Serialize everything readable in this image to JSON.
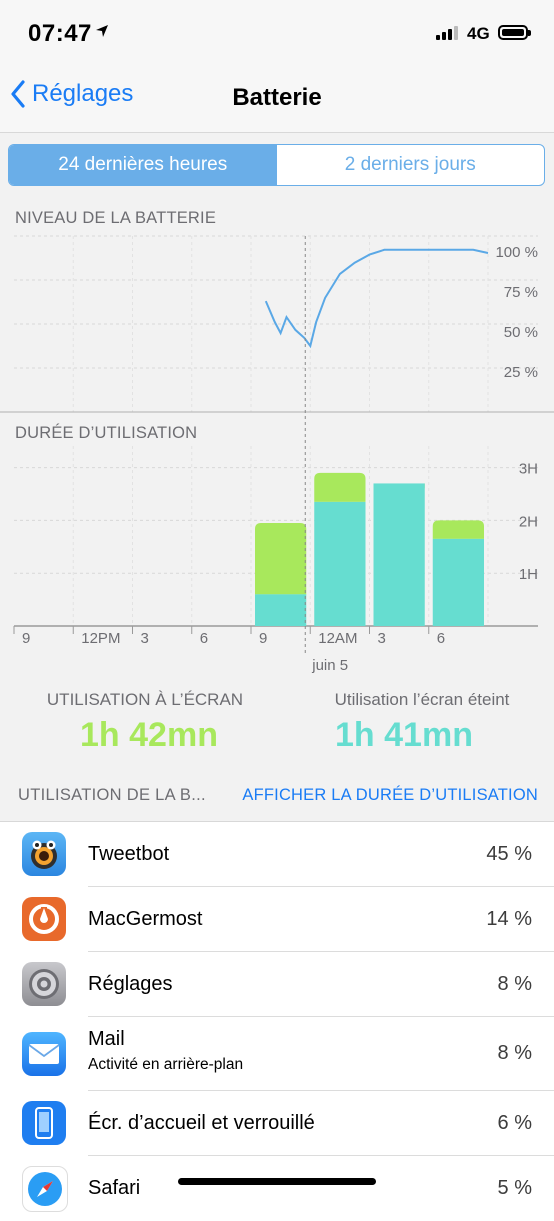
{
  "status": {
    "time": "07:47",
    "network": "4G"
  },
  "nav": {
    "back_label": "Réglages",
    "title": "Batterie"
  },
  "segments": {
    "active": "24 dernières heures",
    "inactive": "2 derniers jours"
  },
  "battery_section": {
    "label": "NIVEAU DE LA BATTERIE"
  },
  "usage_section": {
    "label": "DURÉE D’UTILISATION"
  },
  "chart_data": [
    {
      "type": "line",
      "title": "NIVEAU DE LA BATTERIE",
      "y_ticks": [
        "100 %",
        "75 %",
        "50 %",
        "25 %"
      ],
      "ylim": [
        0,
        100
      ],
      "x_hours": [
        8.5,
        8.8,
        9.0,
        9.2,
        9.5,
        9.8,
        10.0,
        10.2,
        10.5,
        11.0,
        11.5,
        12.0,
        12.5,
        13.0,
        13.5,
        14.0,
        14.5,
        15.0,
        15.5,
        16.0
      ],
      "values": [
        68,
        55,
        48,
        58,
        50,
        45,
        40,
        55,
        70,
        85,
        92,
        97,
        100,
        100,
        100,
        100,
        100,
        100,
        100,
        98
      ],
      "charging_bands": [
        [
          9.4,
          9.5
        ],
        [
          10.3,
          15.8
        ]
      ],
      "grid": true
    },
    {
      "type": "bar",
      "title": "DURÉE D’UTILISATION",
      "x_tick_labels": [
        "9",
        "12PM",
        "3",
        "6",
        "9",
        "12AM",
        "3",
        "6"
      ],
      "date_label": "juin 5",
      "y_ticks": [
        "3H",
        "2H",
        "1H"
      ],
      "ylim": [
        0,
        3
      ],
      "series": [
        {
          "name": "Utilisation à l’écran",
          "color": "#a8e85c",
          "values": [
            0,
            0,
            0,
            0,
            1.35,
            0.55,
            0,
            0.35
          ]
        },
        {
          "name": "Utilisation l’écran éteint",
          "color": "#66ddd0",
          "values": [
            0,
            0,
            0,
            0,
            0.6,
            2.35,
            2.7,
            1.65
          ]
        }
      ],
      "grid": true
    }
  ],
  "stats": {
    "screen_on_label": "UTILISATION À L’ÉCRAN",
    "screen_on_value": "1h 42mn",
    "screen_on_color": "#a8e85c",
    "screen_off_label": "Utilisation l’écran éteint",
    "screen_off_value": "1h 41mn",
    "screen_off_color": "#66ddd0"
  },
  "usage_list": {
    "header_left": "UTILISATION DE LA B...",
    "header_right": "AFFICHER LA DURÉE D’UTILISATION",
    "apps": [
      {
        "name": "Tweetbot",
        "sub": "",
        "pct": "45 %",
        "icon": "tweetbot-icon"
      },
      {
        "name": "MacGermost",
        "sub": "",
        "pct": "14 %",
        "icon": "mattermost-icon"
      },
      {
        "name": "Réglages",
        "sub": "",
        "pct": "8 %",
        "icon": "settings-gear-icon"
      },
      {
        "name": "Mail",
        "sub": "Activité en arrière-plan",
        "pct": "8 %",
        "icon": "mail-envelope-icon"
      },
      {
        "name": "Écr. d’accueil et verrouillé",
        "sub": "",
        "pct": "6 %",
        "icon": "phone-screen-icon"
      },
      {
        "name": "Safari",
        "sub": "",
        "pct": "5 %",
        "icon": "safari-compass-icon"
      }
    ]
  }
}
